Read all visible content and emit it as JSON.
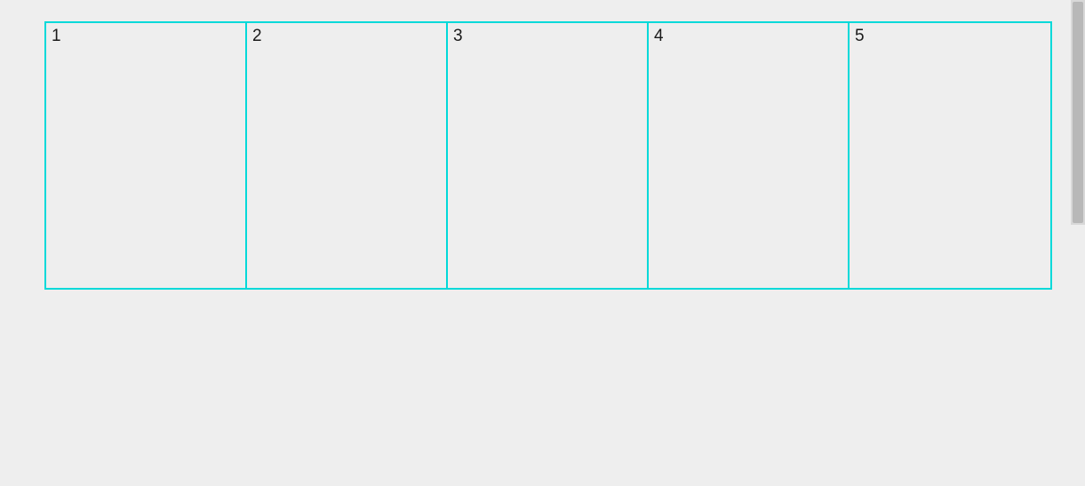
{
  "grid": {
    "cells": [
      {
        "label": "1"
      },
      {
        "label": "2"
      },
      {
        "label": "3"
      },
      {
        "label": "4"
      },
      {
        "label": "5"
      }
    ]
  }
}
